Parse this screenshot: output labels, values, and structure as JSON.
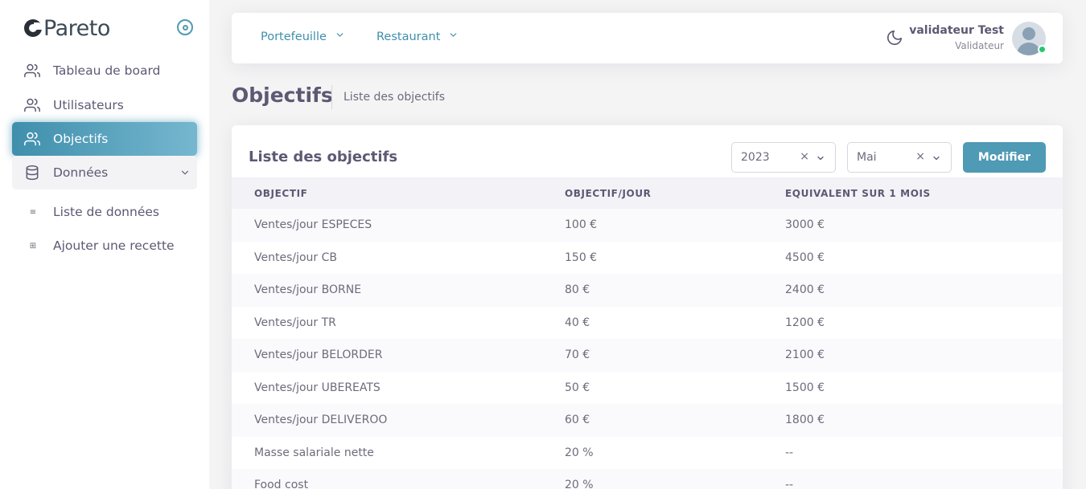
{
  "brand": {
    "name": "Pareto"
  },
  "sidebar": {
    "items": [
      {
        "label": "Tableau de board",
        "icon": "users-icon"
      },
      {
        "label": "Utilisateurs",
        "icon": "users-icon"
      },
      {
        "label": "Objectifs",
        "icon": "users-icon",
        "active": true
      },
      {
        "label": "Données",
        "icon": "database-icon",
        "expanded": true
      }
    ],
    "sub_items": [
      {
        "label": "Liste de données",
        "icon": "list-icon"
      },
      {
        "label": "Ajouter une recette",
        "icon": "plus-square-icon"
      }
    ]
  },
  "navbar": {
    "dropdowns": [
      {
        "label": "Portefeuille"
      },
      {
        "label": "Restaurant"
      }
    ],
    "user": {
      "name": "validateur Test",
      "role": "Validateur",
      "status_color": "#28c76f"
    }
  },
  "header": {
    "title": "Objectifs",
    "breadcrumb": "Liste des objectifs"
  },
  "card": {
    "title": "Liste des objectifs",
    "year_select": {
      "value": "2023"
    },
    "month_select": {
      "value": "Mai"
    },
    "submit_label": "Modifier"
  },
  "table": {
    "columns": [
      "OBJECTIF",
      "OBJECTIF/JOUR",
      "EQUIVALENT SUR 1 MOIS"
    ],
    "rows": [
      [
        "Ventes/jour ESPECES",
        "100 €",
        "3000 €"
      ],
      [
        "Ventes/jour CB",
        "150 €",
        "4500 €"
      ],
      [
        "Ventes/jour BORNE",
        "80 €",
        "2400 €"
      ],
      [
        "Ventes/jour TR",
        "40 €",
        "1200 €"
      ],
      [
        "Ventes/jour BELORDER",
        "70 €",
        "2100 €"
      ],
      [
        "Ventes/jour UBEREATS",
        "50 €",
        "1500 €"
      ],
      [
        "Ventes/jour DELIVEROO",
        "60 €",
        "1800 €"
      ],
      [
        "Masse salariale nette",
        "20 %",
        "--"
      ],
      [
        "Food cost",
        "20 %",
        "--"
      ]
    ]
  },
  "colors": {
    "accent": "#4f9ab4",
    "text": "#5e5873",
    "background": "#f4f4f5"
  }
}
